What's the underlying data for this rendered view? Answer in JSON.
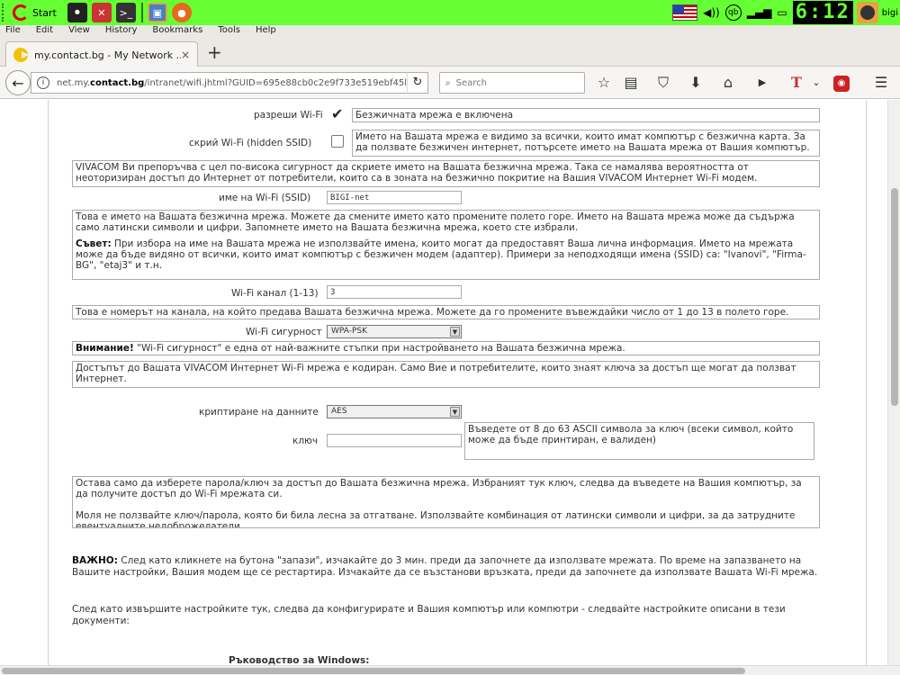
{
  "panel": {
    "start_label": "Start",
    "clock": "6:12",
    "user": "bigi"
  },
  "menu": [
    "File",
    "Edit",
    "View",
    "History",
    "Bookmarks",
    "Tools",
    "Help"
  ],
  "tab": {
    "title": "my.contact.bg - My Network ...",
    "close": "×",
    "new": "+"
  },
  "nav": {
    "url_prefix": "net.my.",
    "url_domain": "contact.bg",
    "url_rest": "/intranet/wifi.jhtml?GUID=695e88cb0c2e9f733e519ebf45l",
    "search_placeholder": "Search"
  },
  "form": {
    "enable_label": "разреши Wi-Fi",
    "enable_checked": true,
    "enable_desc": "Безжичната мрежа е включена",
    "hide_label": "скрий Wi-Fi (hidden SSID)",
    "hide_checked": false,
    "hide_desc": "Името на Вашата мрежа е видимо за всички, които имат компютър с безжична карта. За да ползвате безжичен интернет, потърсете името на Вашата мрежа от Вашия компютър.",
    "recommend": "VIVACOM Ви препоръчва с цел по-висока сигурност да скриете името на Вашата безжична мрежа. Така се намалява вероятността от неоторизиран достъп до Интернет от потребители, които са в зоната на безжично покритие на Вашия VIVACOM Интернет Wi-Fi модем.",
    "ssid_label": "име на Wi-Fi (SSID)",
    "ssid_value": "BIGI-net",
    "ssid_info": "Това е името на Вашата безжична мрежа. Можете да смените името като промените полето горе. Името на Вашата мрежа може да съдържа само латински символи и цифри. Запомнете името на Вашата безжична мрежа, което сте избрали.",
    "advice_bold": "Съвет:",
    "advice_text": " При избора на име на Вашата мрежа не използвайте имена, които могат да предоставят Ваша лична информация. Името на мрежата може да бъде видяно от всички, които имат компютър с безжичен модем (адаптер). Примери за неподходящи имена (SSID) са: \"Ivanovi\", \"Firma-BG\", \"etaj3\" и т.н.",
    "channel_label": "Wi-Fi канал (1-13)",
    "channel_value": "3",
    "channel_info": "Това е номерът на канала, на който предава Вашата безжична мрежа. Можете да го промените въвеждайки число от 1 до 13 в полето горе.",
    "security_label": "Wi-Fi сигурност",
    "security_value": "WPA-PSK",
    "attention_bold": "Внимание!",
    "attention_text": " \"Wi-Fi сигурност\" е една от най-важните стъпки при настройването на Вашата безжична мрежа.",
    "access_info": "Достъпът до Вашата VIVACOM Интернет Wi-Fi мрежа е кодиран. Само Вие и потребителите, които знаят ключа за достъп ще могат да ползват Интернет.",
    "encrypt_label": "криптиране на данните",
    "encrypt_value": "AES",
    "key_label": "ключ",
    "key_value": "",
    "key_hint": "Въведете от 8 до 63 ASCII символа за ключ (всеки символ, който може да бъде принтиран, е валиден)",
    "final1": "Остава само да изберете парола/ключ за достъп до Вашата безжична мрежа. Избраният тук ключ, следва да въведете на Вашия компютър, за да получите достъп до Wi-Fi мрежата си.",
    "final2": "Моля не ползвайте ключ/парола, която би била лесна за отгатване. Използвайте комбинация от латински символи и цифри, за да затрудните евентуалните недоброжелатели.",
    "important_bold": "ВАЖНО:",
    "important_text": " След като кликнете на бутона \"запази\", изчакайте до 3 мин. преди да започнете да използвате мрежата. По време на запазването на Вашите настройки, Вашия модем ще се рестартира. Изчакайте да се възстанови връзката, преди да започнете да използвате Вашата Wi-Fi мрежа.",
    "after_text": "След като извършите настройките тук, следва да конфигурирате и Вашия компютър или компютри - следвайте настройките описани в тези документи:",
    "guide_windows": "Ръководство за Windows:"
  }
}
